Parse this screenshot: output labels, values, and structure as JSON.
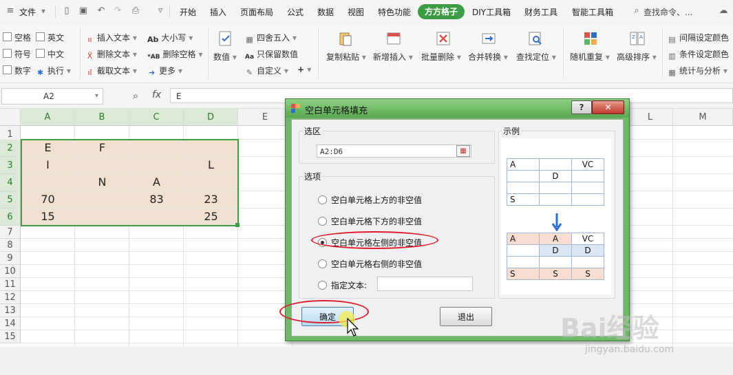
{
  "menu": {
    "file": "文件",
    "tabs": [
      "开始",
      "插入",
      "页面布局",
      "公式",
      "数据",
      "视图",
      "特色功能",
      "方方格子",
      "DIY工具箱",
      "财务工具",
      "智能工具箱"
    ],
    "active_tab": "方方格子",
    "search_placeholder": "查找命令、..."
  },
  "ribbon": {
    "checkbox_group": [
      "空格",
      "英文",
      "符号",
      "中文",
      "数字"
    ],
    "execute": "执行",
    "text_tools": [
      "插入文本",
      "删除文本",
      "截取文本"
    ],
    "case_tools": [
      "大小写",
      "删除空格",
      "更多"
    ],
    "numeric": "数值",
    "round_tools": [
      "四舍五入",
      "只保留数值",
      "自定义"
    ],
    "big_buttons": [
      "复制粘贴",
      "新增插入",
      "批量删除",
      "合并转换",
      "查找定位",
      "随机重复",
      "高级排序"
    ],
    "right_tools": [
      "间隔设定颜色",
      "条件设定颜色",
      "统计与分析"
    ]
  },
  "formula_bar": {
    "name_box": "A2",
    "fx": "fx",
    "value": "E"
  },
  "sheet": {
    "columns": [
      "A",
      "B",
      "C",
      "D",
      "E",
      "",
      "",
      "",
      "",
      "",
      "L",
      "M"
    ],
    "rows": [
      "1",
      "2",
      "3",
      "4",
      "5",
      "6",
      "7",
      "8",
      "9",
      "10",
      "11",
      "12",
      "13",
      "14",
      "15"
    ],
    "cells": {
      "A2": "E",
      "B2": "F",
      "A3": "I",
      "D3": "L",
      "B4": "N",
      "C4": "A",
      "A5": "70",
      "C5": "83",
      "D5": "23",
      "A6": "15",
      "D6": "25"
    }
  },
  "dialog": {
    "title": "空白单元格填充",
    "help": "?",
    "range_group": "选区",
    "range_value": "A2:D6",
    "options_group": "选项",
    "options": [
      "空白单元格上方的非空值",
      "空白单元格下方的非空值",
      "空白单元格左侧的非空值",
      "空白单元格右侧的非空值"
    ],
    "selected_option": 2,
    "custom_text_label": "指定文本:",
    "custom_text_value": "",
    "example_group": "示例",
    "example_before": [
      [
        "A",
        "",
        "VC"
      ],
      [
        "",
        "D",
        ""
      ],
      [
        "",
        "",
        ""
      ],
      [
        "S",
        "",
        ""
      ]
    ],
    "example_after": [
      [
        "A",
        "A",
        "VC"
      ],
      [
        "",
        "D",
        "D"
      ],
      [
        "",
        "",
        ""
      ],
      [
        "S",
        "S",
        "S"
      ]
    ],
    "ok": "确定",
    "exit": "退出"
  },
  "watermark": {
    "brand": "Bai经验",
    "url": "jingyan.baidu.com"
  },
  "colors": {
    "accent": "#3e9c46",
    "fill": "#efe0d0",
    "annotation": "#e0192b"
  }
}
